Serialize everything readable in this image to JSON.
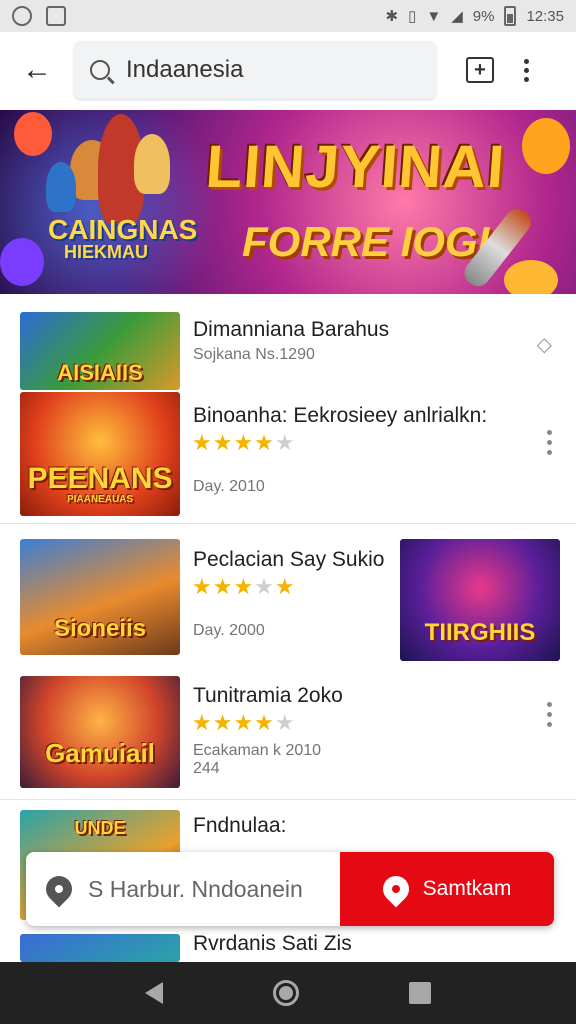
{
  "status_bar": {
    "battery": "9%",
    "time": "12:35"
  },
  "search": {
    "value": "Indaanesia"
  },
  "banner": {
    "title_main": "LINJYINAI",
    "title_sub": "FORRE IOGI",
    "left_title": "CAINGNAS",
    "left_sub": "HIEKMAU"
  },
  "results": [
    {
      "title": "Dimanniana Barahus",
      "subtitle": "Sojkana Ns.1290",
      "thumb_caption": "AISIAIIS"
    },
    {
      "title": "Binoanha: Eekrosieey anlrialkn:",
      "subtitle": "Day. 2010",
      "rating": 4,
      "thumb_caption": "PEENANS",
      "thumb_sub": "PIAANEAUAS"
    },
    {
      "title": "Peclacian Say Sukio",
      "subtitle": "Day. 2000",
      "rating": 3,
      "thumb_caption": "Sioneiis",
      "side_caption": "TIIRGHIIS"
    },
    {
      "title": "Tunitramia 2oko",
      "subtitle": "Ecakaman k 2010",
      "subtitle2": "244",
      "rating": 4,
      "thumb_caption": "Gamuiail"
    },
    {
      "title": "Fndnulaa:",
      "thumb_caption": "UNDE"
    },
    {
      "title": "Rvrdanis Sati Zis"
    }
  ],
  "bottom_bar": {
    "location_text": "S  Harbur. Nndoanein",
    "action_label": "Samtkam"
  },
  "colors": {
    "accent_red": "#e50914",
    "star": "#f5b400"
  }
}
